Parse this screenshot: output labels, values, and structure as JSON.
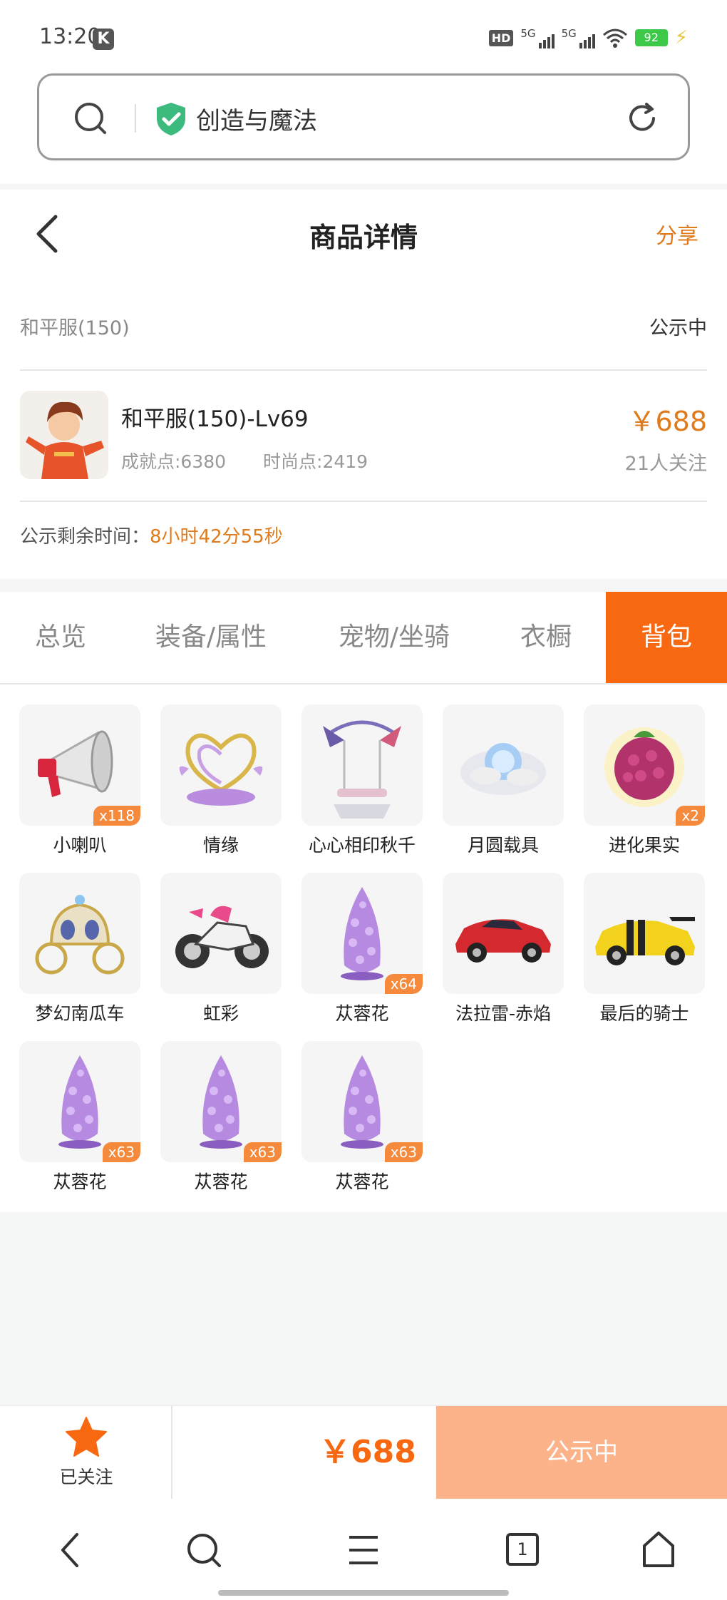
{
  "status_bar": {
    "time": "13:20",
    "k_badge": "K",
    "hd_label": "HD",
    "sig1_label": "5G",
    "sig2_label": "5G",
    "battery": "92"
  },
  "browser": {
    "site_name": "创造与魔法"
  },
  "header": {
    "title": "商品详情",
    "share": "分享"
  },
  "product": {
    "server": "和平服(150)",
    "status": "公示中",
    "name": "和平服(150)-Lv69",
    "achievement": "成就点:6380",
    "fashion": "时尚点:2419",
    "price": "￥688",
    "followers": "21人关注",
    "countdown_label": "公示剩余时间：",
    "countdown_value": "8小时42分55秒"
  },
  "tabs": [
    {
      "label": "总览"
    },
    {
      "label": "装备/属性"
    },
    {
      "label": "宠物/坐骑"
    },
    {
      "label": "衣橱"
    },
    {
      "label": "背包",
      "active": true
    }
  ],
  "items": [
    {
      "name": "小喇叭",
      "count": "x118",
      "icon": "megaphone-icon"
    },
    {
      "name": "情缘",
      "count": "",
      "icon": "heart-ornament-icon"
    },
    {
      "name": "心心相印秋千",
      "count": "",
      "icon": "swing-icon"
    },
    {
      "name": "月圆载具",
      "count": "",
      "icon": "moon-orb-icon"
    },
    {
      "name": "进化果实",
      "count": "x2",
      "icon": "berry-icon"
    },
    {
      "name": "梦幻南瓜车",
      "count": "",
      "icon": "carriage-icon"
    },
    {
      "name": "虹彩",
      "count": "",
      "icon": "motorcycle-icon"
    },
    {
      "name": "苁蓉花",
      "count": "x64",
      "icon": "cistanche-flower-icon"
    },
    {
      "name": "法拉雷-赤焰",
      "count": "",
      "icon": "red-car-icon"
    },
    {
      "name": "最后的骑士",
      "count": "",
      "icon": "yellow-car-icon"
    },
    {
      "name": "苁蓉花",
      "count": "x63",
      "icon": "cistanche-flower-icon"
    },
    {
      "name": "苁蓉花",
      "count": "x63",
      "icon": "cistanche-flower-icon"
    },
    {
      "name": "苁蓉花",
      "count": "x63",
      "icon": "cistanche-flower-icon"
    }
  ],
  "action_bar": {
    "follow_label": "已关注",
    "price": "￥688",
    "button": "公示中"
  },
  "browser_nav": {
    "tab_count": "1"
  },
  "colors": {
    "accent": "#f86811",
    "price": "#e07b1c",
    "badge": "#f58a3c",
    "button_disabled": "#fcb38a"
  }
}
